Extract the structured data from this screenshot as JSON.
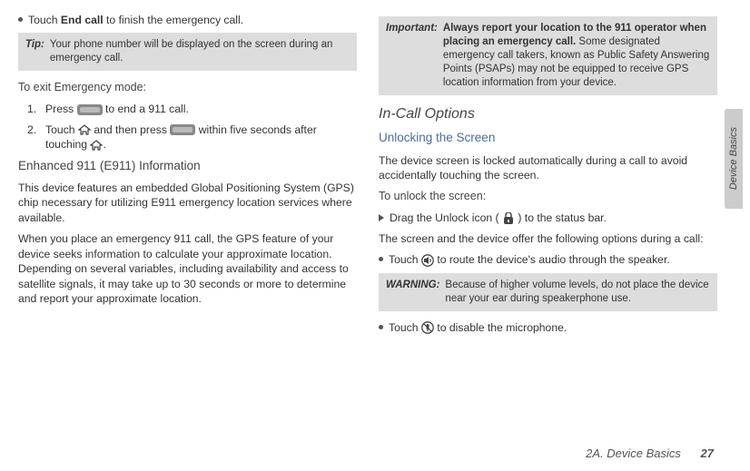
{
  "left": {
    "bullet1_pre": "Touch ",
    "bullet1_bold": "End call",
    "bullet1_post": " to finish the emergency call.",
    "tip_label": "Tip:",
    "tip_text": "Your phone number will be displayed on the screen during an emergency call.",
    "exit_head": "To exit Emergency mode:",
    "step1_num": "1.",
    "step1_a": "Press ",
    "step1_b": " to end a 911 call.",
    "step2_num": "2.",
    "step2_a": "Touch ",
    "step2_b": " and then press ",
    "step2_c": " within five seconds after touching ",
    "step2_d": ".",
    "e911_head": "Enhanced 911 (E911) Information",
    "para1": "This device features an embedded Global Positioning System (GPS) chip necessary for utilizing E911 emergency location services where available.",
    "para2": "When you place an emergency 911 call, the GPS feature of your device seeks information to calculate your approximate location. Depending on several variables, including availability and access to satellite signals, it may take up to 30 seconds or more to determine and report your approximate location."
  },
  "right": {
    "imp_label": "Important:",
    "imp_bold": "Always report your location to the 911 operator when placing an emergency call.",
    "imp_rest": " Some designated emergency call takers, known as Public Safety Answering Points (PSAPs) may not be equipped to receive GPS location information from your device.",
    "incall_head": "In-Call Options",
    "unlock_head": "Unlocking the Screen",
    "unlock_para": "The device screen is locked automatically during a call to avoid accidentally touching the screen.",
    "unlock_sub": "To unlock the screen:",
    "drag_a": "Drag the Unlock icon (",
    "drag_b": ") to the status bar.",
    "options_para": "The screen and the device offer the following options during a call:",
    "speaker_a": "Touch ",
    "speaker_b": " to route the device's audio through the speaker.",
    "warn_label": "WARNING:",
    "warn_text": "Because of higher volume levels, do not place the device near your ear during speakerphone use.",
    "mute_a": "Touch ",
    "mute_b": " to disable the microphone."
  },
  "footer": {
    "section": "2A. Device Basics",
    "page": "27"
  },
  "sidetab": "Device Basics"
}
